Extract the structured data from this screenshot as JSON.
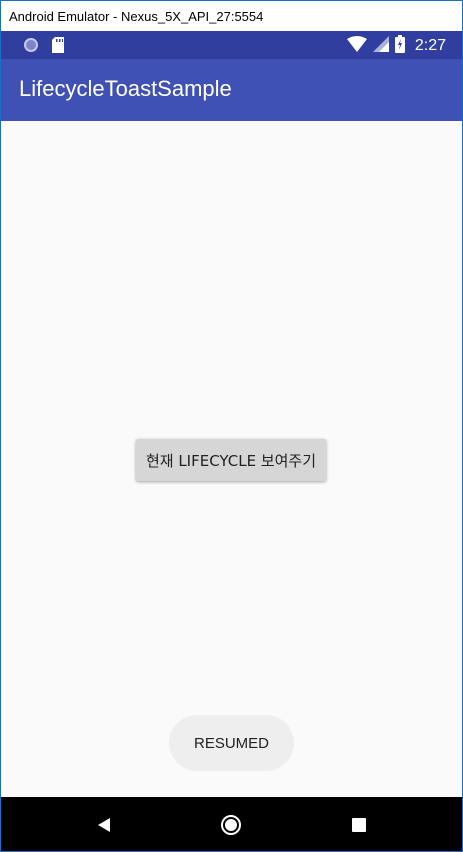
{
  "window": {
    "title": "Android Emulator - Nexus_5X_API_27:5554"
  },
  "status_bar": {
    "time": "2:27",
    "icons": [
      "circle-notification-icon",
      "sd-card-icon",
      "wifi-icon",
      "signal-icon",
      "battery-charging-icon"
    ]
  },
  "app_bar": {
    "title": "LifecycleToastSample"
  },
  "main": {
    "button_label": "현재 LIFECYCLE 보여주기"
  },
  "toast": {
    "text": "RESUMED"
  },
  "nav_bar": {
    "icons": [
      "back-icon",
      "home-icon",
      "recents-icon"
    ]
  },
  "colors": {
    "status_bar": "#303f9f",
    "app_bar": "#3f51b5",
    "background": "#fafafa",
    "button": "#d6d6d6",
    "toast": "#eeeeee",
    "nav_bar": "#000000"
  }
}
